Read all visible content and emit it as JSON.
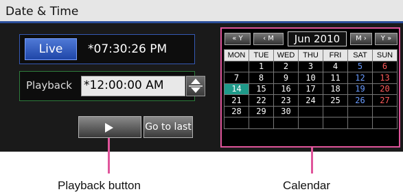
{
  "window": {
    "title": "Date & Time"
  },
  "live": {
    "label": "Live",
    "time": "*07:30:26 PM"
  },
  "playback": {
    "label": "Playback",
    "time": "*12:00:00 AM"
  },
  "controls": {
    "play_icon": "play-icon",
    "goto_last_label": "Go to last"
  },
  "calendar": {
    "nav": {
      "prev_year": "« Y",
      "prev_month": "‹ M",
      "month_label": "Jun 2010",
      "next_month": "M ›",
      "next_year": "Y »"
    },
    "weekdays": [
      "MON",
      "TUE",
      "WED",
      "THU",
      "FRI",
      "SAT",
      "SUN"
    ],
    "weeks": [
      [
        "",
        "1",
        "2",
        "3",
        "4",
        "5",
        "6"
      ],
      [
        "7",
        "8",
        "9",
        "10",
        "11",
        "12",
        "13"
      ],
      [
        "14",
        "15",
        "16",
        "17",
        "18",
        "19",
        "20"
      ],
      [
        "21",
        "22",
        "23",
        "24",
        "25",
        "26",
        "27"
      ],
      [
        "28",
        "29",
        "30",
        "",
        "",
        "",
        ""
      ],
      [
        "",
        "",
        "",
        "",
        "",
        "",
        ""
      ]
    ],
    "selected_day": "14",
    "colors": {
      "saturday": "#6a9cff",
      "sunday": "#ff5b5b",
      "selected": "#1f9a8a",
      "frame_highlight": "#e0559b"
    }
  },
  "annotations": {
    "playback_button": "Playback button",
    "calendar": "Calendar"
  }
}
